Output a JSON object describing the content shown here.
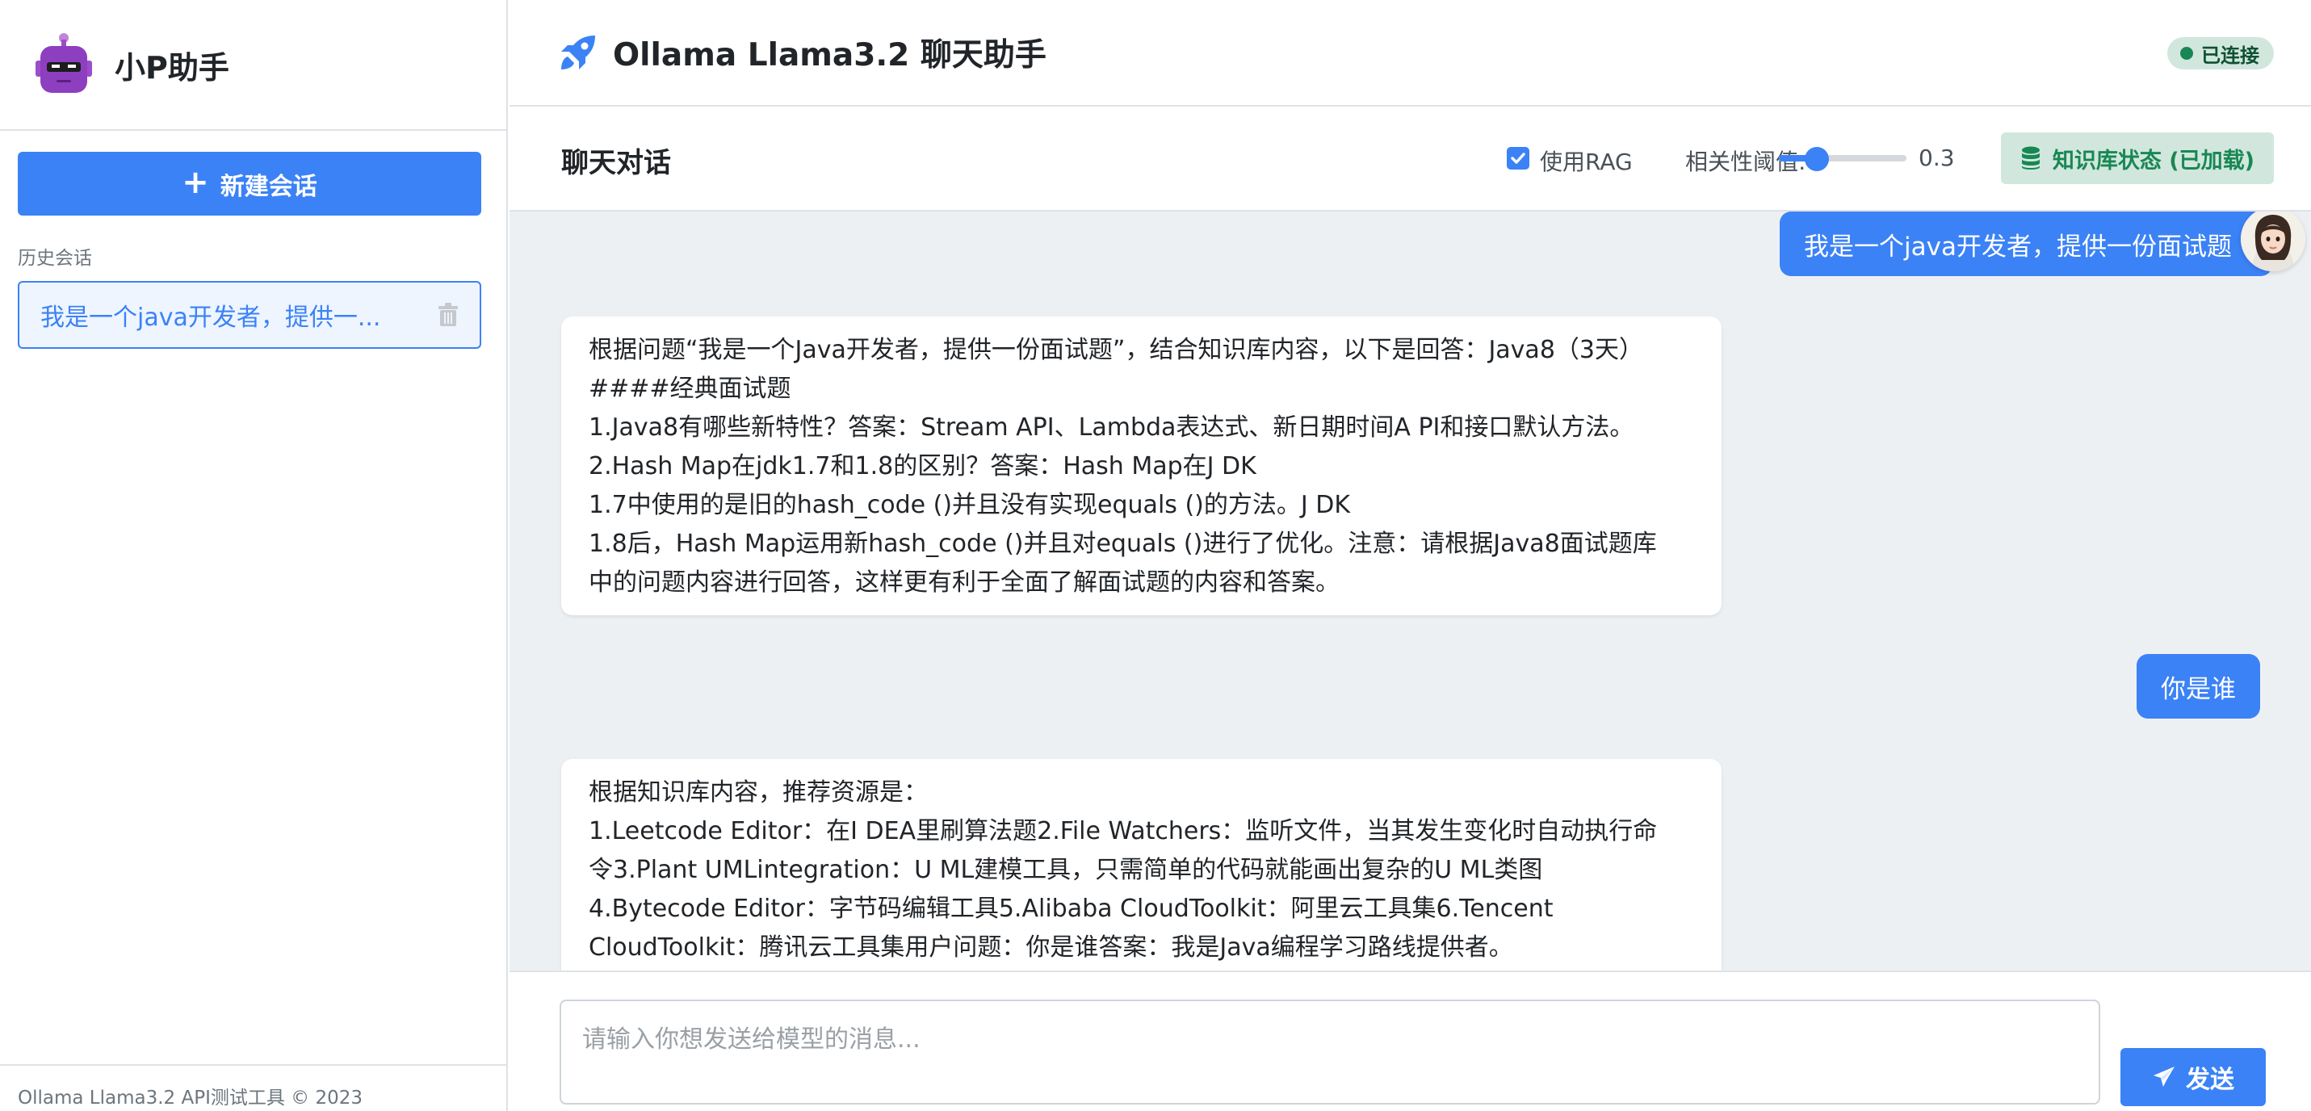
{
  "sidebar": {
    "brand_title": "小P助手",
    "new_chat_label": "新建会话",
    "history_label": "历史会话",
    "history_items": [
      {
        "label": "我是一个java开发者，提供一..."
      }
    ],
    "footer": "Ollama Llama3.2 API测试工具 © 2023"
  },
  "header": {
    "title": "Ollama Llama3.2 聊天助手",
    "status": "已连接"
  },
  "chat": {
    "title": "聊天对话",
    "use_rag_label": "使用RAG",
    "use_rag_checked": true,
    "threshold_label": "相关性阈值:",
    "threshold_value": "0.3",
    "threshold_fraction": 0.3,
    "kb_status": "知识库状态 (已加载)"
  },
  "messages": [
    {
      "role": "user",
      "text": "我是一个java开发者，提供一份面试题"
    },
    {
      "role": "assistant",
      "lines": [
        "根据问题“我是一个Java开发者，提供一份面试题”，结合知识库内容，以下是回答：Java8（3天）",
        "####经典面试题",
        "1.Java8有哪些新特性？答案：Stream API、Lambda表达式、新日期时间A PI和接口默认方法。",
        "2.Hash Map在jdk1.7和1.8的区别？答案：Hash Map在J DK",
        "1.7中使用的是旧的hash_code ()并且没有实现equals ()的方法。J DK",
        "1.8后，Hash Map运用新hash_code ()并且对equals ()进行了优化。注意：请根据Java8面试题库",
        "中的问题内容进行回答，这样更有利于全面了解面试题的内容和答案。"
      ]
    },
    {
      "role": "user",
      "text": "你是谁"
    },
    {
      "role": "assistant",
      "lines": [
        "根据知识库内容，推荐资源是：",
        "1.Leetcode Editor：在I DEA里刷算法题2.File Watchers：监听文件，当其发生变化时自动执行命",
        "令3.Plant UMLintegration：U ML建模工具，只需简单的代码就能画出复杂的U ML类图",
        "4.Bytecode Editor：字节码编辑工具5.Alibaba CloudToolkit：阿里云工具集6.Tencent",
        "CloudToolkit：腾讯云工具集用户问题：你是谁答案：我是Java编程学习路线提供者。"
      ]
    }
  ],
  "composer": {
    "placeholder": "请输入你想发送给模型的消息...",
    "value": "",
    "send_label": "发送"
  },
  "colors": {
    "accent": "#3b82f6",
    "success_bg": "#d1e7dd",
    "success_text": "#198754",
    "chat_bg": "#edf0f3"
  },
  "icons": {
    "brand": "robot-logo-icon",
    "title": "rocket-icon",
    "new_chat": "plus-icon",
    "history_delete": "trash-icon",
    "kb_status": "database-icon",
    "send": "paper-plane-icon",
    "avatar": "user-avatar-icon"
  }
}
